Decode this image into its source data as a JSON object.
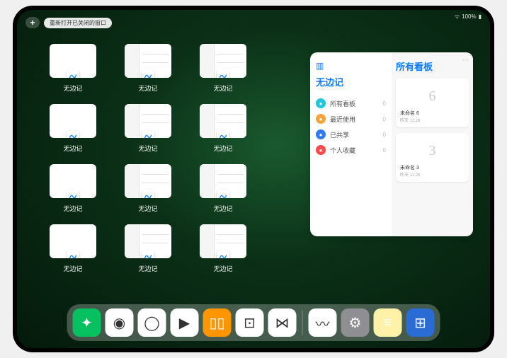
{
  "status": {
    "wifi": "᯼",
    "battery": "100%"
  },
  "topbar": {
    "plus": "+",
    "reopen_label": "重新打开已关闭的窗口"
  },
  "app": {
    "name": "无边记",
    "thumbnails": [
      {
        "style": "blank"
      },
      {
        "style": "split"
      },
      {
        "style": "split"
      },
      {
        "style": "blank"
      },
      {
        "style": "split"
      },
      {
        "style": "split"
      },
      {
        "style": "blank"
      },
      {
        "style": "split"
      },
      {
        "style": "split"
      },
      {
        "style": "blank"
      },
      {
        "style": "split"
      },
      {
        "style": "split"
      }
    ]
  },
  "sidebar": {
    "title": "无边记",
    "boards_title": "所有看板",
    "items": [
      {
        "label": "所有看板",
        "color": "#21c5de",
        "count": "0"
      },
      {
        "label": "最近使用",
        "color": "#f6a43a",
        "count": "0"
      },
      {
        "label": "已共享",
        "color": "#2f7cf6",
        "count": "0"
      },
      {
        "label": "个人收藏",
        "color": "#ff4a4a",
        "count": "0"
      }
    ],
    "boards": [
      {
        "glyph": "6",
        "name": "未命名 6",
        "date": "昨天 11:28"
      },
      {
        "glyph": "3",
        "name": "未命名 3",
        "date": "昨天 11:26"
      }
    ]
  },
  "dock": {
    "apps": [
      {
        "name": "wechat",
        "bg": "#07c160",
        "glyph": "✦"
      },
      {
        "name": "browser1",
        "bg": "#ffffff",
        "glyph": "◉"
      },
      {
        "name": "browser2",
        "bg": "#ffffff",
        "glyph": "◯"
      },
      {
        "name": "play",
        "bg": "#ffffff",
        "glyph": "▶"
      },
      {
        "name": "books",
        "bg": "#ff9500",
        "glyph": "▯▯"
      },
      {
        "name": "dice",
        "bg": "#ffffff",
        "glyph": "⊡"
      },
      {
        "name": "connect",
        "bg": "#ffffff",
        "glyph": "⋈"
      }
    ],
    "recent": [
      {
        "name": "freeform",
        "bg": "#ffffff",
        "glyph": "〰"
      },
      {
        "name": "settings",
        "bg": "#8e8e93",
        "glyph": "⚙"
      },
      {
        "name": "notes",
        "bg": "#fff2a8",
        "glyph": "≡"
      },
      {
        "name": "library",
        "bg": "#2b6cd4",
        "glyph": "⊞"
      }
    ]
  }
}
